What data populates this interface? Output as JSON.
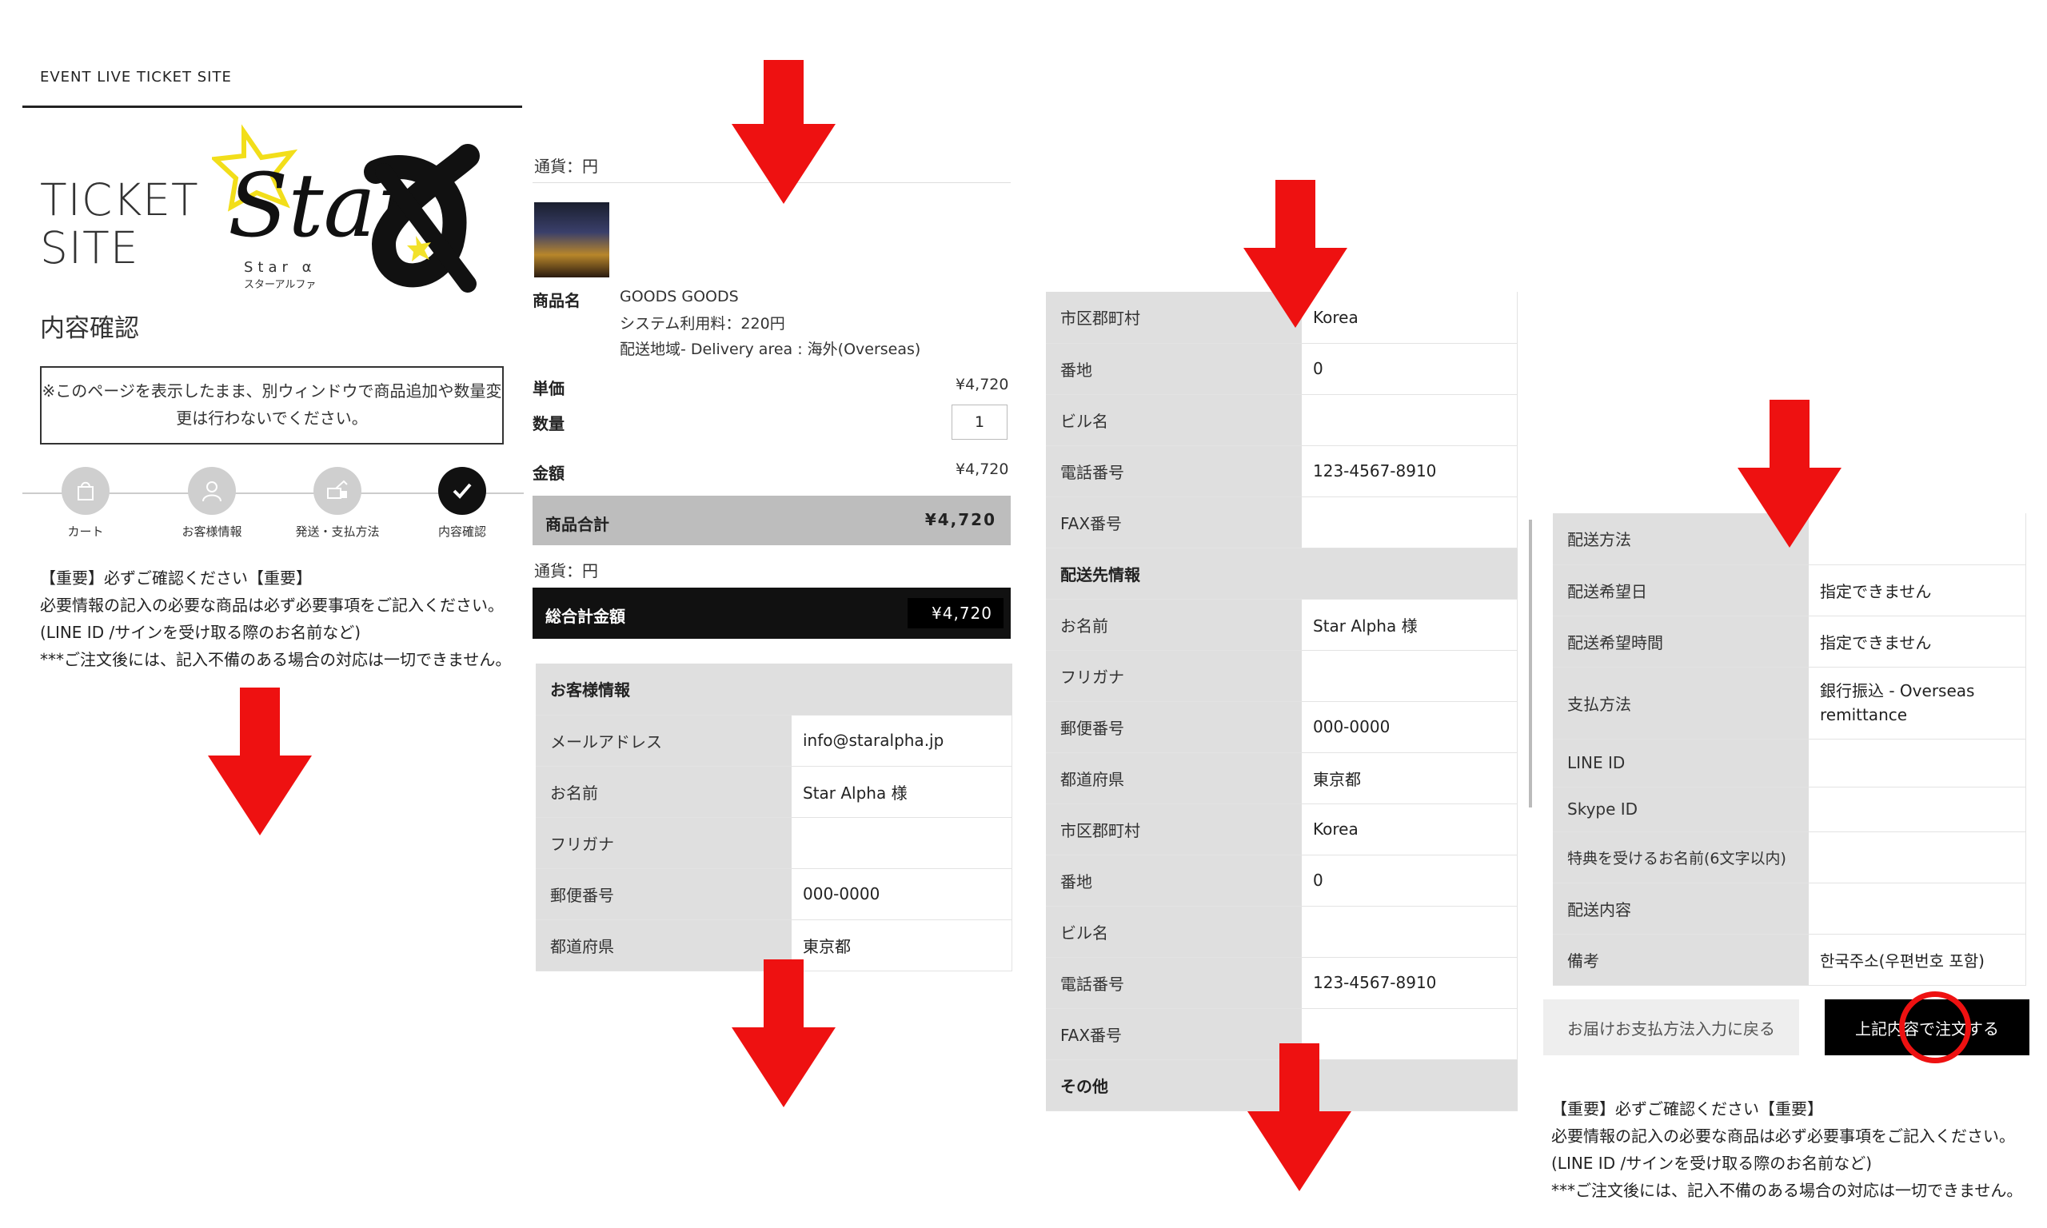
{
  "site_label": "EVENT LIVE TICKET SITE",
  "ticket_site": [
    "TICKET",
    "SITE"
  ],
  "logo": {
    "text": "StarX",
    "sub": "Star α",
    "kana": "スターアルファ"
  },
  "page_title": "内容確認",
  "notice": "※このページを表示したまま、別ウィンドウで商品追加や数量変更は行わないでください。",
  "steps": [
    {
      "label": "カート",
      "icon": "cart-icon"
    },
    {
      "label": "お客様情報",
      "icon": "user-icon"
    },
    {
      "label": "発送・支払方法",
      "icon": "delivery-icon"
    },
    {
      "label": "内容確認",
      "icon": "check-icon"
    }
  ],
  "important": {
    "line1": "【重要】必ずご確認ください【重要】",
    "line2": "必要情報の記入の必要な商品は必ず必要事項をご記入ください。(LINE ID /サインを受け取る際のお名前など)",
    "line3": "***ご注文後には、記入不備のある場合の対応は一切できません。"
  },
  "order": {
    "currency": "通貨：円",
    "product_name_label": "商品名",
    "product_name": "GOODS GOODS",
    "system_fee": "システム利用料：220円",
    "delivery_area": "配送地域- Delivery area : 海外(Overseas)",
    "unit_price_label": "単価",
    "unit_price": "¥4,720",
    "quantity_label": "数量",
    "quantity": "1",
    "amount_label": "金額",
    "amount": "¥4,720",
    "subtotal_label": "商品合計",
    "subtotal": "¥4,720",
    "currency2": "通貨：円",
    "grand_total_label": "総合計金額",
    "grand_total": "¥4,720"
  },
  "customer": {
    "header": "お客様情報",
    "rows": [
      {
        "k": "メールアドレス",
        "v": "info@staralpha.jp"
      },
      {
        "k": "お名前",
        "v": "Star Alpha 様"
      },
      {
        "k": "フリガナ",
        "v": ""
      },
      {
        "k": "郵便番号",
        "v": "000-0000"
      },
      {
        "k": "都道府県",
        "v": "東京都"
      }
    ]
  },
  "address_panel": {
    "rows_top": [
      {
        "k": "市区郡町村",
        "v": "Korea"
      },
      {
        "k": "番地",
        "v": "0"
      },
      {
        "k": "ビル名",
        "v": ""
      },
      {
        "k": "電話番号",
        "v": "123-4567-8910"
      },
      {
        "k": "FAX番号",
        "v": ""
      }
    ],
    "shipping_header": "配送先情報",
    "rows_ship": [
      {
        "k": "お名前",
        "v": "Star Alpha 様"
      },
      {
        "k": "フリガナ",
        "v": ""
      },
      {
        "k": "郵便番号",
        "v": "000-0000"
      },
      {
        "k": "都道府県",
        "v": "東京都"
      },
      {
        "k": "市区郡町村",
        "v": "Korea"
      },
      {
        "k": "番地",
        "v": "0"
      },
      {
        "k": "ビル名",
        "v": ""
      },
      {
        "k": "電話番号",
        "v": "123-4567-8910"
      },
      {
        "k": "FAX番号",
        "v": ""
      }
    ],
    "other_header": "その他"
  },
  "delivery_panel": {
    "rows": [
      {
        "k": "配送方法",
        "v": ""
      },
      {
        "k": "配送希望日",
        "v": "指定できません"
      },
      {
        "k": "配送希望時間",
        "v": "指定できません"
      },
      {
        "k": "支払方法",
        "v": "銀行振込 - Overseas remittance"
      },
      {
        "k": "LINE ID",
        "v": ""
      },
      {
        "k": "Skype ID",
        "v": ""
      },
      {
        "k": "特典を受けるお名前(6文字以内)",
        "v": ""
      },
      {
        "k": "配送内容",
        "v": ""
      },
      {
        "k": "備考",
        "v": "한국주소(우편번호 포함)"
      }
    ],
    "back_button": "お届けお支払方法入力に戻る",
    "order_button": "上記内容で注文する"
  },
  "colors": {
    "arrow": "#ee1111",
    "dark": "#111111",
    "gray": "#dfdfdf"
  }
}
